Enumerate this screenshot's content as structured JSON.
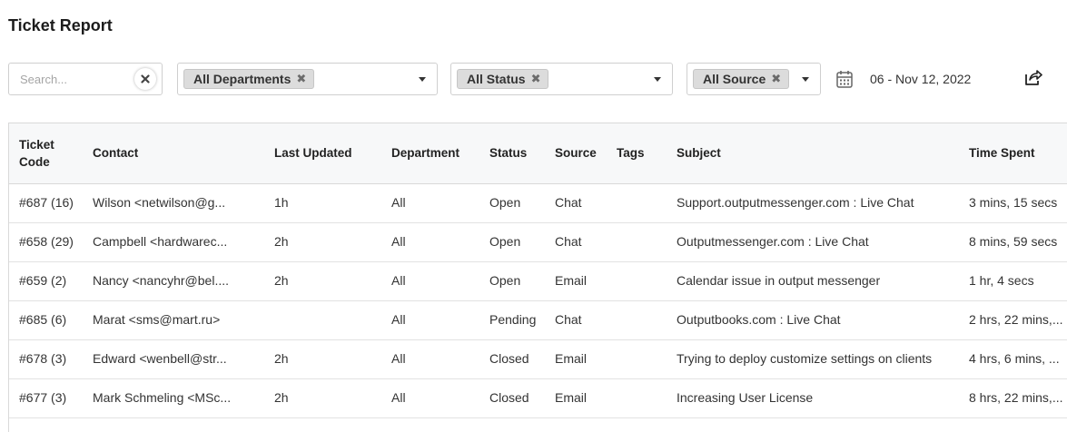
{
  "page": {
    "title": "Ticket Report"
  },
  "filters": {
    "search_placeholder": "Search...",
    "clear_glyph": "✖",
    "department": "All Departments",
    "status": "All Status",
    "source": "All Source",
    "chip_remove_glyph": "✖",
    "date_range": "06 - Nov 12, 2022"
  },
  "icons": {
    "clear": "x-icon",
    "calendar": "calendar-icon",
    "export": "export-share-icon",
    "dropdown": "chevron-down-icon"
  },
  "table": {
    "columns": {
      "ticket_code": "Ticket\nCode",
      "contact": "Contact",
      "last_updated": "Last Updated",
      "department": "Department",
      "status": "Status",
      "source": "Source",
      "tags": "Tags",
      "subject": "Subject",
      "time_spent": "Time Spent"
    },
    "rows": [
      {
        "ticket_code": "#687 (16)",
        "contact": "Wilson <netwilson@g...",
        "last_updated": "1h",
        "department": "All",
        "status": "Open",
        "source": "Chat",
        "tags": "",
        "subject": "Support.outputmessenger.com : Live Chat",
        "time_spent": "3 mins, 15 secs"
      },
      {
        "ticket_code": "#658 (29)",
        "contact": "Campbell <hardwarec...",
        "last_updated": "2h",
        "department": "All",
        "status": "Open",
        "source": "Chat",
        "tags": "",
        "subject": "Outputmessenger.com : Live Chat",
        "time_spent": "8 mins, 59 secs"
      },
      {
        "ticket_code": "#659 (2)",
        "contact": "Nancy <nancyhr@bel....",
        "last_updated": "2h",
        "department": "All",
        "status": "Open",
        "source": "Email",
        "tags": "",
        "subject": "Calendar issue in output messenger",
        "time_spent": "1 hr, 4 secs"
      },
      {
        "ticket_code": "#685 (6)",
        "contact": "Marat <sms@mart.ru>",
        "last_updated": "",
        "department": "All",
        "status": "Pending",
        "source": "Chat",
        "tags": "",
        "subject": "Outputbooks.com : Live Chat",
        "time_spent": "2 hrs, 22 mins,..."
      },
      {
        "ticket_code": "#678 (3)",
        "contact": "Edward <wenbell@str...",
        "last_updated": "2h",
        "department": "All",
        "status": "Closed",
        "source": "Email",
        "tags": "",
        "subject": "Trying to deploy customize settings on clients",
        "time_spent": "4 hrs, 6 mins, ..."
      },
      {
        "ticket_code": "#677 (3)",
        "contact": "Mark Schmeling <MSc...",
        "last_updated": "2h",
        "department": "All",
        "status": "Closed",
        "source": "Email",
        "tags": "",
        "subject": "Increasing User License",
        "time_spent": "8 hrs, 22 mins,..."
      }
    ]
  }
}
